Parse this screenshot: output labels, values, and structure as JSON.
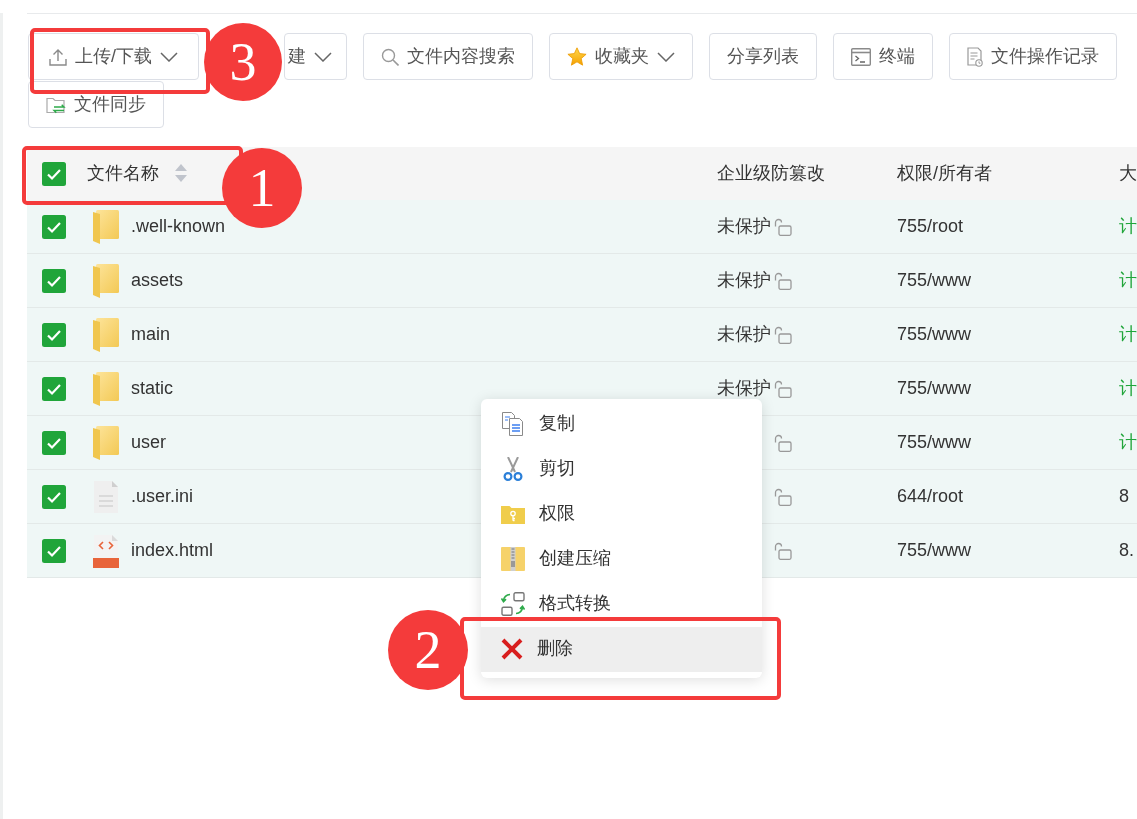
{
  "toolbar": [
    {
      "label": "上传/下载",
      "dropdown": true
    },
    {
      "label": "建",
      "dropdown": true
    },
    {
      "label": "文件内容搜索",
      "dropdown": false
    },
    {
      "label": "收藏夹",
      "dropdown": true
    },
    {
      "label": "分享列表",
      "dropdown": false
    },
    {
      "label": "终端",
      "dropdown": false
    },
    {
      "label": "文件操作记录",
      "dropdown": false
    },
    {
      "label": "文件同步",
      "dropdown": false
    }
  ],
  "file_table": {
    "all_checked": true,
    "columns": [
      {
        "label": "文件名称",
        "sortable": true
      },
      {
        "label": "企业级防篡改",
        "sortable": false
      },
      {
        "label": "权限/所有者",
        "sortable": false
      },
      {
        "label": "大"
      }
    ],
    "rows": [
      {
        "checked": true,
        "kind": "folder",
        "name": ".well-known",
        "protection": "未保护",
        "permission": "755/root",
        "size": {
          "text": "计",
          "kind": "link"
        }
      },
      {
        "checked": true,
        "kind": "folder",
        "name": "assets",
        "protection": "未保护",
        "permission": "755/www",
        "size": {
          "text": "计",
          "kind": "link"
        }
      },
      {
        "checked": true,
        "kind": "folder",
        "name": "main",
        "protection": "未保护",
        "permission": "755/www",
        "size": {
          "text": "计",
          "kind": "link"
        }
      },
      {
        "checked": true,
        "kind": "folder",
        "name": "static",
        "protection": "未保护",
        "permission": "755/www",
        "size": {
          "text": "计",
          "kind": "link"
        }
      },
      {
        "checked": true,
        "kind": "folder",
        "name": "user",
        "permission": "755/www",
        "size": {
          "text": "计",
          "kind": "link"
        }
      },
      {
        "checked": true,
        "kind": "file",
        "name": ".user.ini",
        "permission": "644/root",
        "size": {
          "text": "8",
          "kind": "text"
        }
      },
      {
        "checked": true,
        "kind": "html",
        "name": "index.html",
        "permission": "755/www",
        "size": {
          "text": "8.",
          "kind": "text"
        }
      }
    ]
  },
  "context_menu": {
    "items": [
      {
        "label": "复制",
        "highlighted": false
      },
      {
        "label": "剪切",
        "highlighted": false
      },
      {
        "label": "权限",
        "highlighted": false
      },
      {
        "label": "创建压缩",
        "highlighted": false
      },
      {
        "label": "格式转换",
        "highlighted": false
      },
      {
        "label": "删除",
        "highlighted": true
      }
    ]
  },
  "annotations": [
    {
      "number": "3"
    },
    {
      "number": "1"
    },
    {
      "number": "2"
    }
  ]
}
